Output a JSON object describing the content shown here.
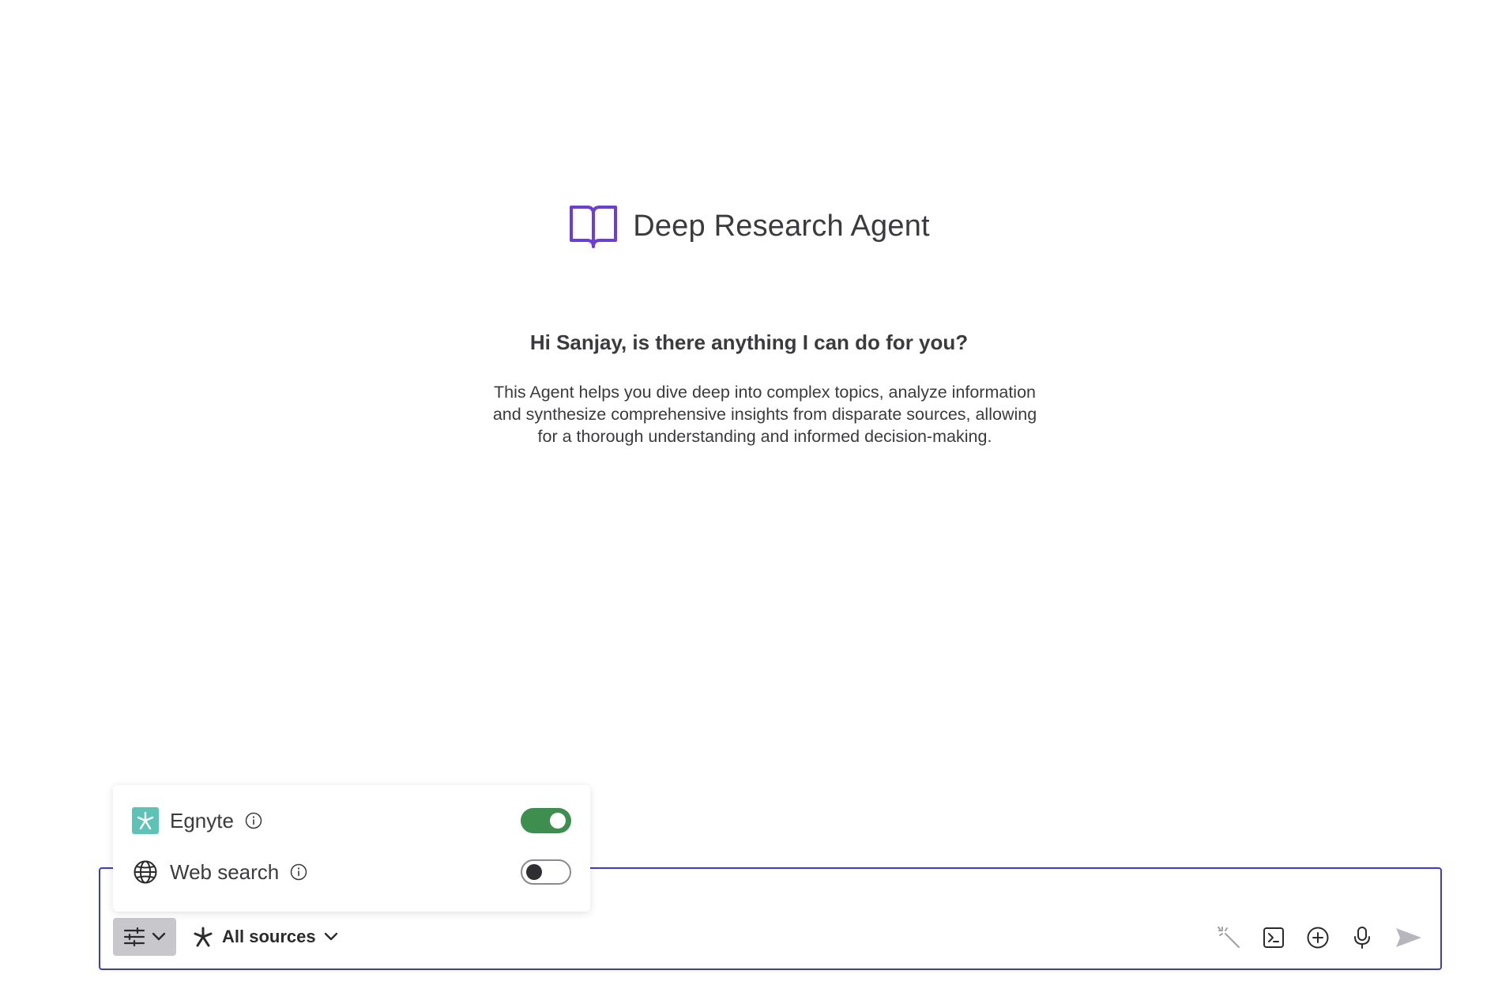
{
  "agent": {
    "title": "Deep Research Agent",
    "greeting": "Hi Sanjay, is there anything I can do for you?",
    "description": "This Agent helps you dive deep into complex topics, analyze information and synthesize comprehensive insights from disparate sources, allowing for a thorough understanding and informed decision-making.",
    "icon": "book-icon",
    "icon_color": "#6a3fd1"
  },
  "composer": {
    "border_color": "#3d3bbf",
    "sources_label": "All sources",
    "actions": [
      "magic-wand-icon",
      "prompt-terminal-icon",
      "add-circle-icon",
      "microphone-icon",
      "send-icon"
    ]
  },
  "sources_popover": {
    "items": [
      {
        "name": "Egnyte",
        "icon": "egnyte-logo-icon",
        "enabled": true
      },
      {
        "name": "Web search",
        "icon": "globe-icon",
        "enabled": false
      }
    ],
    "toggle_on_color": "#3e8e4f"
  }
}
